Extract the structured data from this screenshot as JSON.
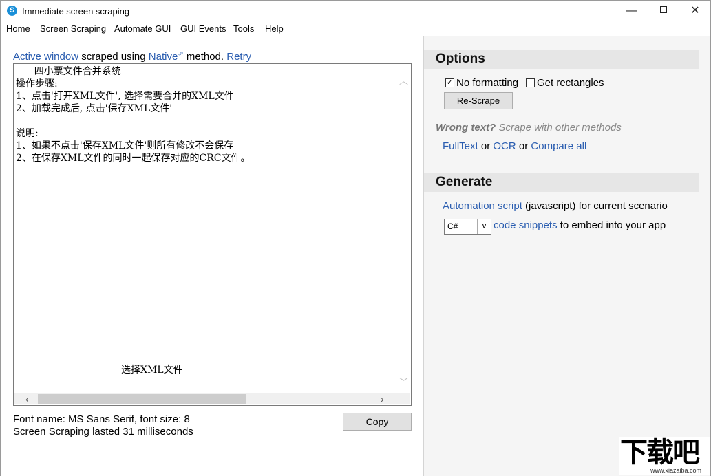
{
  "window": {
    "title": "Immediate screen scraping",
    "minimize_glyph": "—",
    "close_glyph": "✕"
  },
  "menu": [
    "Home",
    "Screen Scraping",
    "Automate GUI",
    "GUI Events",
    "Tools",
    "Help"
  ],
  "scrape": {
    "active_window_link": "Active window",
    "scraped_using": " scraped using ",
    "native_link": "Native",
    "method_text": " method. ",
    "retry_link": "Retry",
    "text_lines": "      四小票文件合并系统\n操作步骤:\n1、点击'打开XML文件', 选择需要合并的XML文件\n2、加载完成后, 点击'保存XML文件'\n\n说明:\n1、如果不点击'保存XML文件'则所有修改不会保存\n2、在保存XML文件的同时一起保存对应的CRC文件。",
    "bottom_caption": "选择XML文件",
    "font_info": "Font name: MS Sans Serif, font size: 8",
    "duration": "Screen Scraping lasted 31 milliseconds",
    "copy_label": "Copy"
  },
  "options": {
    "header": "Options",
    "no_formatting_label": "No formatting",
    "no_formatting_checked": true,
    "get_rectangles_label": "Get rectangles",
    "get_rectangles_checked": false,
    "rescrape_label": "Re-Scrape",
    "wrong_text_bold": "Wrong text?",
    "wrong_text_rest": " Scrape with other methods",
    "fulltext_link": "FullText",
    "or1": " or ",
    "ocr_link": "OCR",
    "or2": " or ",
    "compare_link": "Compare all"
  },
  "generate": {
    "header": "Generate",
    "automation_link": "Automation script",
    "automation_rest": " (javascript) for current scenario",
    "language_selected": "C#",
    "snippets_link": "code snippets",
    "snippets_rest": " to embed into your app"
  },
  "watermark": {
    "logo_text": "下载吧",
    "url": "www.xiazaiba.com"
  },
  "colors": {
    "link": "#2a5db0",
    "right_panel_bg": "#f5f5f5",
    "section_header_bg": "#e6e6e6"
  }
}
